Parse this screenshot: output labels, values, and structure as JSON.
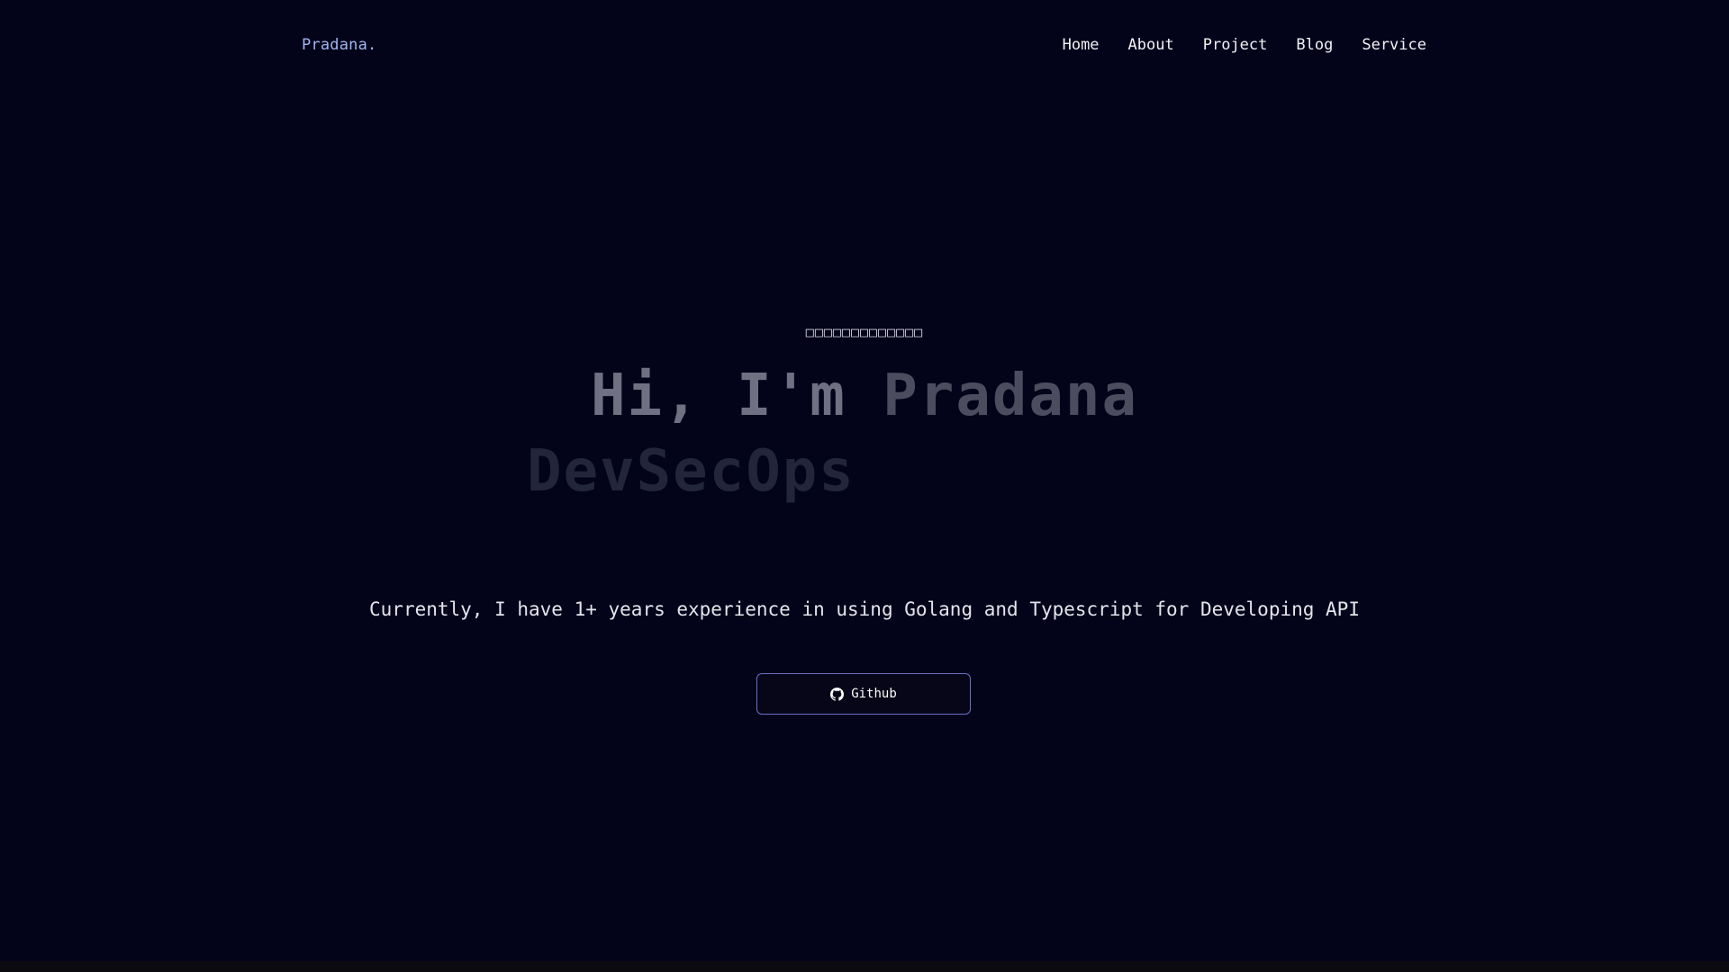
{
  "header": {
    "brand": "Pradana.",
    "nav": [
      "Home",
      "About",
      "Project",
      "Blog",
      "Service"
    ]
  },
  "hero": {
    "kicker": "□□□□□□□□□□□□□",
    "greeting": "Hi, I'm ",
    "name": "Pradana",
    "role": "DevSecOps",
    "tagline": "Currently, I have 1+ years experience in using Golang and Typescript for Developing API",
    "github_button": "Github",
    "github_icon": "github-icon"
  },
  "colors": {
    "background": "#03031a",
    "brand": "#9fb7ee",
    "button_border": "#6a6fc7"
  }
}
